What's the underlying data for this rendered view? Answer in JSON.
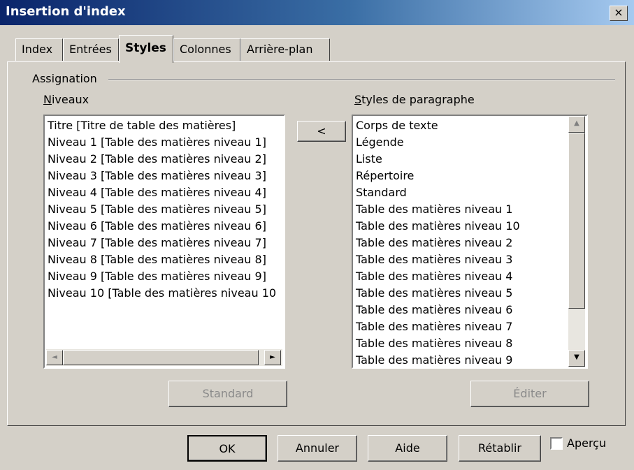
{
  "window": {
    "title": "Insertion d'index",
    "close_glyph": "×"
  },
  "tabs": [
    {
      "label": "Index"
    },
    {
      "label": "Entrées"
    },
    {
      "label": "Styles"
    },
    {
      "label": "Colonnes"
    },
    {
      "label": "Arrière-plan"
    }
  ],
  "active_tab": "Styles",
  "assignation": {
    "group_label": "Assignation",
    "levels_label": "Niveaux",
    "levels": [
      "Titre [Titre de table des matières]",
      "Niveau 1 [Table des matières niveau 1]",
      "Niveau 2 [Table des matières niveau 2]",
      "Niveau 3 [Table des matières niveau 3]",
      "Niveau 4 [Table des matières niveau 4]",
      "Niveau 5 [Table des matières niveau 5]",
      "Niveau 6 [Table des matières niveau 6]",
      "Niveau 7 [Table des matières niveau 7]",
      "Niveau 8 [Table des matières niveau 8]",
      "Niveau 9 [Table des matières niveau 9]",
      "Niveau 10 [Table des matières niveau 10"
    ],
    "assign_button": "<",
    "styles_label": "Styles de paragraphe",
    "styles": [
      "Corps de texte",
      "Légende",
      "Liste",
      "Répertoire",
      "Standard",
      "Table des matières niveau 1",
      "Table des matières niveau 10",
      "Table des matières niveau 2",
      "Table des matières niveau 3",
      "Table des matières niveau 4",
      "Table des matières niveau 5",
      "Table des matières niveau 6",
      "Table des matières niveau 7",
      "Table des matières niveau 8",
      "Table des matières niveau 9"
    ],
    "standard_button": "Standard",
    "edit_button": "Éditer"
  },
  "footer": {
    "ok": "OK",
    "cancel": "Annuler",
    "help": "Aide",
    "reset": "Rétablir",
    "preview_label": "Aperçu",
    "preview_checked": false
  },
  "icons": {
    "scroll_left": "◄",
    "scroll_right": "►",
    "scroll_up": "▲",
    "scroll_down": "▼"
  }
}
